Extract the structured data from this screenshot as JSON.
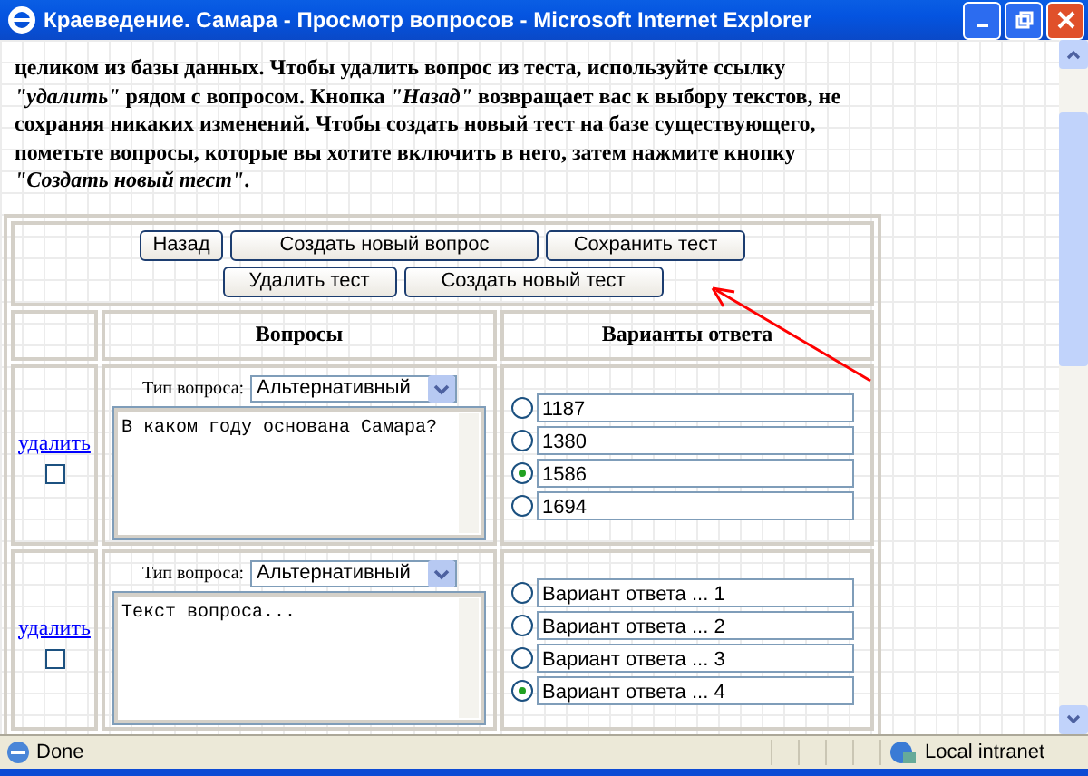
{
  "window": {
    "title": "Краеведение. Самара - Просмотр вопросов - Microsoft Internet Explorer"
  },
  "instructions": "целиком из базы данных. Чтобы удалить вопрос из теста, используйте ссылку *\"удалить\"* рядом с вопросом. Кнопка *\"Назад\"* возвращает вас к выбору текстов, не сохраняя никаких изменений. Чтобы создать новый тест на базе существующего, пометьте вопросы, которые вы хотите включить в него, затем нажмите кнопку *\"Создать новый тест\"*.",
  "button_rows": [
    [
      "Назад",
      "Создать новый вопрос",
      "Сохранить тест"
    ],
    [
      "Удалить тест",
      "Создать новый тест"
    ]
  ],
  "table": {
    "columns": [
      "Вопросы",
      "Варианты ответа"
    ],
    "questions": [
      {
        "delete_link": "удалить",
        "checked": false,
        "type_label": "Тип вопроса:",
        "type": "Альтернативный",
        "text": "В каком году основана Самара?",
        "answers": [
          {
            "text": "1187",
            "selected": false
          },
          {
            "text": "1380",
            "selected": false
          },
          {
            "text": "1586",
            "selected": true
          },
          {
            "text": "1694",
            "selected": false
          }
        ]
      },
      {
        "delete_link": "удалить",
        "checked": false,
        "type_label": "Тип вопроса:",
        "type": "Альтернативный",
        "text": "Текст вопроса...",
        "answers": [
          {
            "text": "Вариант ответа ... 1",
            "selected": false
          },
          {
            "text": "Вариант ответа ... 2",
            "selected": false
          },
          {
            "text": "Вариант ответа ... 3",
            "selected": false
          },
          {
            "text": "Вариант ответа ... 4",
            "selected": true
          }
        ]
      }
    ]
  },
  "status_bar": {
    "text": "Done",
    "zone": "Local intranet"
  }
}
